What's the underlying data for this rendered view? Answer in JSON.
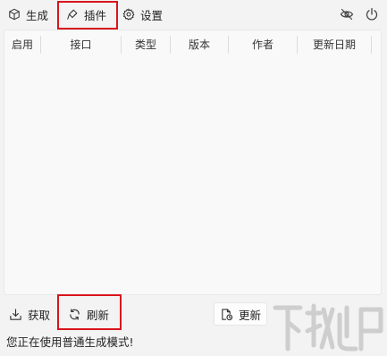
{
  "tabs": {
    "generate": "生成",
    "plugin": "插件",
    "settings": "设置"
  },
  "table": {
    "columns": [
      "启用",
      "接口",
      "类型",
      "版本",
      "作者",
      "更新日期"
    ],
    "rows": []
  },
  "toolbar": {
    "fetch_label": "获取",
    "refresh_label": "刷新",
    "update_label": "更新"
  },
  "status_text": "您正在使用普通生成模式!",
  "icons": {
    "generate": "cube-icon",
    "plugin": "plug-icon",
    "settings": "gear-icon",
    "visibility": "eye-off-icon",
    "power": "power-icon",
    "fetch": "download-tray-icon",
    "refresh": "refresh-icon",
    "update": "document-clock-icon"
  },
  "colors": {
    "highlight": "#d8141c",
    "background": "#f3f3f3"
  }
}
